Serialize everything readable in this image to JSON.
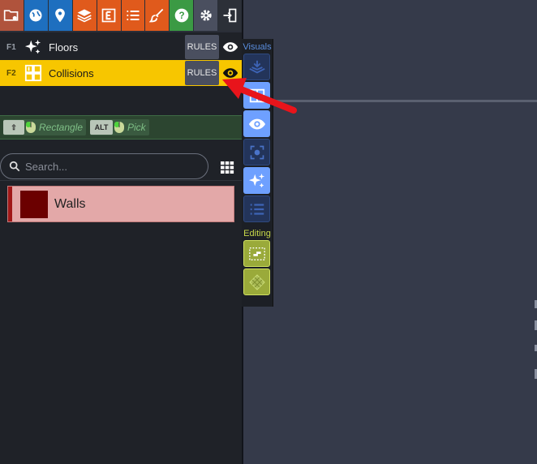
{
  "toolbar": {
    "buttons": [
      {
        "name": "folder-settings-icon",
        "color": "#b0533c"
      },
      {
        "name": "globe-icon",
        "color": "#1e6fbf"
      },
      {
        "name": "map-pin-icon",
        "color": "#1e6fbf"
      },
      {
        "name": "layers-icon",
        "color": "#e05a1c"
      },
      {
        "name": "entity-icon",
        "color": "#e05a1c"
      },
      {
        "name": "list-icon",
        "color": "#e05a1c"
      },
      {
        "name": "brush-icon",
        "color": "#e05a1c"
      },
      {
        "name": "help-icon",
        "color": "#3b9a44"
      },
      {
        "name": "gear-icon",
        "color": "#4a4f5f"
      },
      {
        "name": "exit-icon",
        "color": "#2c3038"
      }
    ]
  },
  "layers": [
    {
      "key": "F1",
      "name": "Floors",
      "rules_label": "RULES",
      "selected": false,
      "icon": "sparkle-icon"
    },
    {
      "key": "F2",
      "name": "Collisions",
      "rules_label": "RULES",
      "selected": true,
      "icon": "grid-collision-icon"
    }
  ],
  "modes": {
    "rectangle": {
      "key": "⇧",
      "label": "Rectangle"
    },
    "pick": {
      "key": "ALT",
      "label": "Pick"
    }
  },
  "search": {
    "placeholder": "Search...",
    "value": ""
  },
  "tiles": [
    {
      "label": "Walls",
      "color": "#6b0000"
    }
  ],
  "side_panel": {
    "visuals_label": "Visuals",
    "editing_label": "Editing",
    "visuals_buttons": [
      "layers-stack-icon",
      "tiles-icon",
      "eye-icon",
      "focus-icon",
      "sparkle-icon",
      "list-icon"
    ],
    "editing_buttons": [
      "select-rectangle-icon",
      "hatch-icon"
    ]
  },
  "colors": {
    "selected_layer": "#f7c600",
    "arrow": "#e8141b",
    "visuals_heading": "#5b8fe0",
    "editing_heading": "#c8d84a"
  }
}
